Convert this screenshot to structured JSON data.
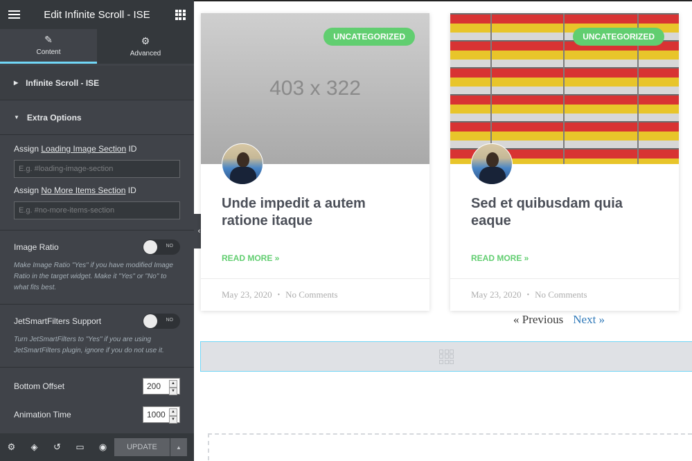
{
  "panel": {
    "title": "Edit Infinite Scroll - ISE",
    "tabs": [
      {
        "label": "Content",
        "icon": "pencil-icon"
      },
      {
        "label": "Advanced",
        "icon": "gear-icon"
      }
    ],
    "sections": [
      {
        "label": "Infinite Scroll - ISE",
        "state": "collapsed"
      },
      {
        "label": "Extra Options",
        "state": "expanded"
      }
    ],
    "loading_section": {
      "prefix": "Assign ",
      "link": "Loading Image Section",
      "suffix": " ID",
      "placeholder": "E.g. #loading-image-section"
    },
    "no_more_section": {
      "prefix": "Assign ",
      "link": "No More Items Section",
      "suffix": " ID",
      "placeholder": "E.g. #no-more-items-section"
    },
    "image_ratio": {
      "label": "Image Ratio",
      "toggle": "NO",
      "description": "Make Image Ratio \"Yes\" if you have modified Image Ratio in the target widget. Make it \"Yes\" or \"No\" to what fits best."
    },
    "jetsmart": {
      "label": "JetSmartFilters Support",
      "toggle": "NO",
      "description": "Turn JetSmartFilters to \"Yes\" if you are using JetSmartFilters plugin, ignore if you do not use it."
    },
    "bottom_offset": {
      "label": "Bottom Offset",
      "value": "200"
    },
    "animation_time": {
      "label": "Animation Time",
      "value": "1000"
    },
    "footer": {
      "icons": [
        "gear-icon",
        "layers-icon",
        "history-icon",
        "responsive-icon",
        "eye-icon"
      ],
      "update_label": "UPDATE"
    }
  },
  "posts": [
    {
      "category": "UNCATEGORIZED",
      "image_text": "403 x 322",
      "title": "Unde impedit a autem ratione itaque",
      "read_more": "READ MORE »",
      "date": "May 23, 2020",
      "comments": "No Comments"
    },
    {
      "category": "UNCATEGORIZED",
      "image_text": "",
      "title": "Sed et quibusdam quia eaque",
      "read_more": "READ MORE »",
      "date": "May 23, 2020",
      "comments": "No Comments"
    }
  ],
  "pagination": {
    "previous": "« Previous",
    "next": "Next »"
  },
  "colors": {
    "accent_green": "#61ce70",
    "panel_bg": "#404349",
    "link_blue": "#2e78b8",
    "active_tab": "#71d7f7"
  }
}
